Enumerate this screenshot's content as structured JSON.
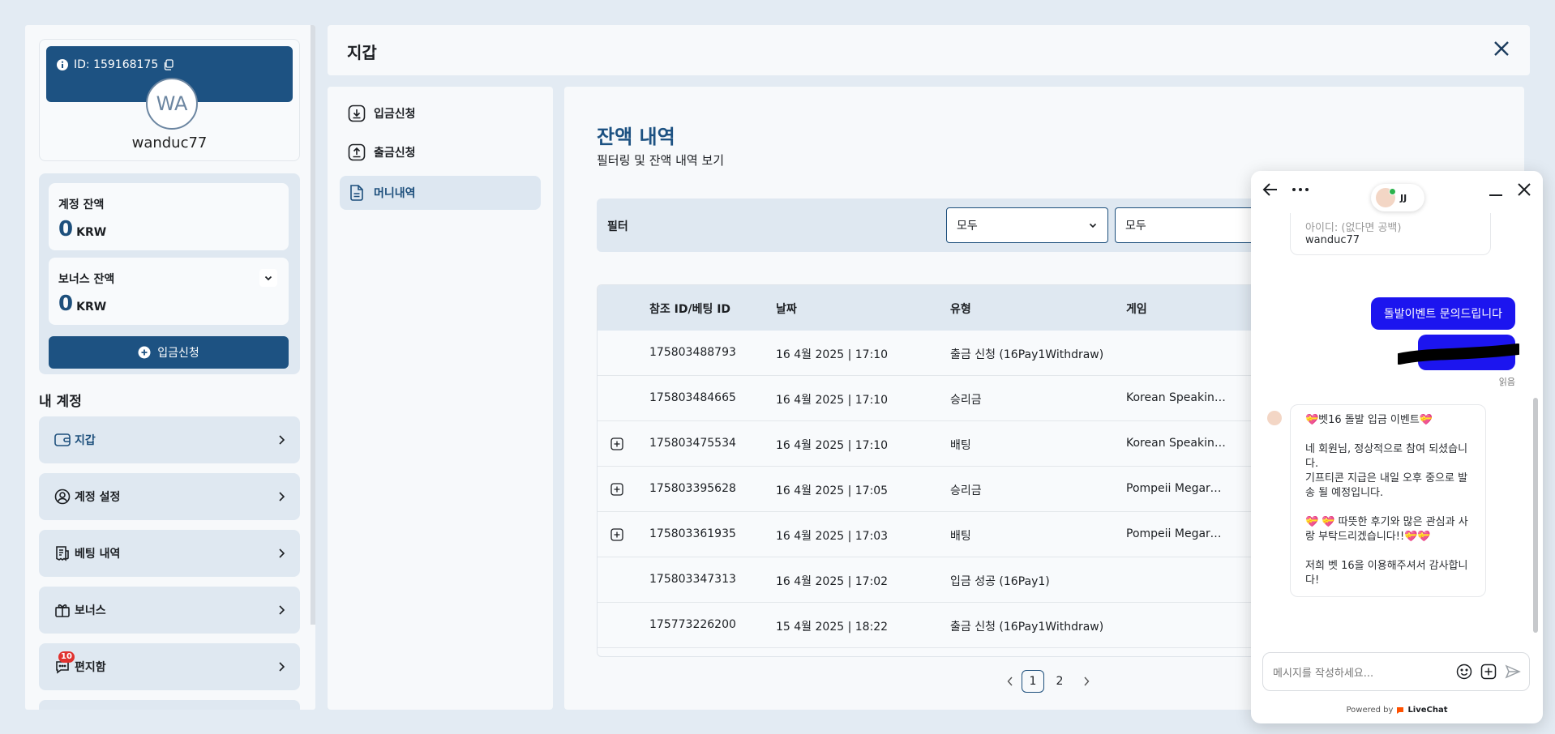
{
  "profile": {
    "id_label": "ID: 159168175",
    "initials": "WA",
    "username": "wanduc77"
  },
  "balances": {
    "account": {
      "label": "계정 잔액",
      "value": "0",
      "currency": "KRW"
    },
    "bonus": {
      "label": "보너스 잔액",
      "value": "0",
      "currency": "KRW"
    },
    "deposit_button": "입금신청"
  },
  "my_account": {
    "heading": "내 계정",
    "items": [
      {
        "label": "지갑",
        "icon": "wallet-icon"
      },
      {
        "label": "계정 설정",
        "icon": "user-icon"
      },
      {
        "label": "베팅 내역",
        "icon": "receipt-icon"
      },
      {
        "label": "보너스",
        "icon": "gift-icon"
      },
      {
        "label": "편지함",
        "icon": "chat-icon",
        "badge": "10"
      }
    ]
  },
  "page": {
    "title": "지갑"
  },
  "side_menu": [
    {
      "label": "입금신청",
      "icon": "download-icon"
    },
    {
      "label": "출금신청",
      "icon": "upload-icon"
    },
    {
      "label": "머니내역",
      "icon": "document-icon",
      "active": true
    }
  ],
  "content": {
    "title": "잔액 내역",
    "subtitle": "필터링 및 잔액 내역 보기",
    "filter": {
      "label": "필터",
      "select1": "모두",
      "select2": "모두"
    },
    "table": {
      "headers": {
        "ref": "참조 ID/베팅 ID",
        "date": "날짜",
        "type": "유형",
        "game": "게임"
      },
      "rows": [
        {
          "ref": "175803488793",
          "date": "16 4월 2025 | 17:10",
          "type": "출금 신청 (16Pay1Withdraw)",
          "game": "",
          "expandable": false
        },
        {
          "ref": "175803484665",
          "date": "16 4월 2025 | 17:10",
          "type": "승리금",
          "game": "Korean Speakin…",
          "expandable": false
        },
        {
          "ref": "175803475534",
          "date": "16 4월 2025 | 17:10",
          "type": "배팅",
          "game": "Korean Speakin…",
          "expandable": true
        },
        {
          "ref": "175803395628",
          "date": "16 4월 2025 | 17:05",
          "type": "승리금",
          "game": "Pompeii Megare…",
          "expandable": true
        },
        {
          "ref": "175803361935",
          "date": "16 4월 2025 | 17:03",
          "type": "배팅",
          "game": "Pompeii Megare…",
          "expandable": true
        },
        {
          "ref": "175803347313",
          "date": "16 4월 2025 | 17:02",
          "type": "입금 성공 (16Pay1)",
          "game": "",
          "expandable": false
        },
        {
          "ref": "175773226200",
          "date": "15 4월 2025 | 18:22",
          "type": "출금 신청 (16Pay1Withdraw)",
          "game": "",
          "expandable": false
        }
      ]
    },
    "pagination": {
      "current": "1",
      "next": "2"
    }
  },
  "chat": {
    "agent_initials": "JJ",
    "prev_message_line1": "아이디: (없다면 공백)",
    "prev_message_line2": "wanduc77",
    "user_message": "돌발이벤트 문의드립니다",
    "read_label": "읽음",
    "agent_reply": {
      "title": "💝벳16 돌발 입금 이벤트💝",
      "p1": "네 회원님, 정상적으로 참여 되셨습니다.",
      "p2": "기프티콘 지급은 내일 오후 중으로 발송 될 예정입니다.",
      "p3": "💝 💝 따뜻한 후기와 많은 관심과 사랑 부탁드리겠습니다!!💝💝",
      "p4": "저희 벳 16을 이용해주셔서 감사합니다!"
    },
    "input_placeholder": "메시지를 작성하세요...",
    "powered_by": "Powered by",
    "brand": "LiveChat"
  },
  "colors": {
    "primary": "#1d5282",
    "chat_accent": "#1c15ef",
    "badge": "#e0322f"
  }
}
